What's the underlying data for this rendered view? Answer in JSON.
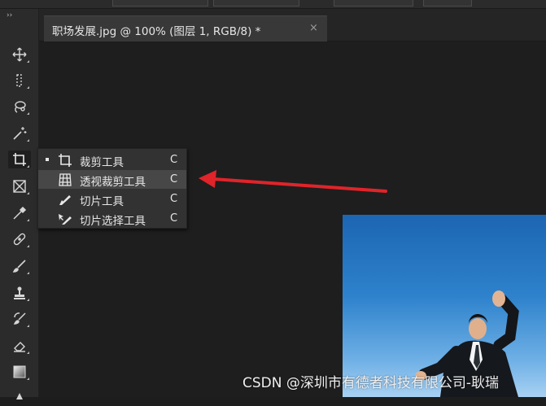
{
  "document_tab": {
    "title": "职场发展.jpg @ 100% (图层 1, RGB/8) *",
    "close_symbol": "×"
  },
  "toolbar": {
    "collapse_symbol": "››",
    "tools": [
      {
        "name": "move-tool",
        "icon": "move-icon"
      },
      {
        "name": "marquee-tool",
        "icon": "marquee-icon"
      },
      {
        "name": "lasso-tool",
        "icon": "lasso-icon"
      },
      {
        "name": "magic-wand-tool",
        "icon": "magic-wand-icon"
      },
      {
        "name": "crop-tool",
        "icon": "crop-icon",
        "active": true
      },
      {
        "name": "frame-tool",
        "icon": "frame-icon"
      },
      {
        "name": "eyedropper-tool",
        "icon": "eyedropper-icon"
      },
      {
        "name": "healing-brush-tool",
        "icon": "bandage-icon"
      },
      {
        "name": "brush-tool",
        "icon": "brush-icon"
      },
      {
        "name": "stamp-tool",
        "icon": "stamp-icon"
      },
      {
        "name": "history-brush-tool",
        "icon": "history-brush-icon"
      },
      {
        "name": "eraser-tool",
        "icon": "eraser-icon"
      },
      {
        "name": "gradient-tool",
        "icon": "gradient-icon"
      }
    ]
  },
  "crop_flyout": {
    "items": [
      {
        "label": "裁剪工具",
        "shortcut": "C",
        "icon": "crop-icon",
        "selected": true
      },
      {
        "label": "透视裁剪工具",
        "shortcut": "C",
        "icon": "perspective-crop-icon",
        "highlighted": true
      },
      {
        "label": "切片工具",
        "shortcut": "C",
        "icon": "slice-icon"
      },
      {
        "label": "切片选择工具",
        "shortcut": "C",
        "icon": "slice-select-icon"
      }
    ]
  },
  "watermark": "CSDN @深圳市有德者科技有限公司-耿瑞",
  "colors": {
    "annotation_arrow": "#e0242a",
    "panel_bg": "#2b2b2b",
    "canvas_bg": "#1e1e1e"
  }
}
